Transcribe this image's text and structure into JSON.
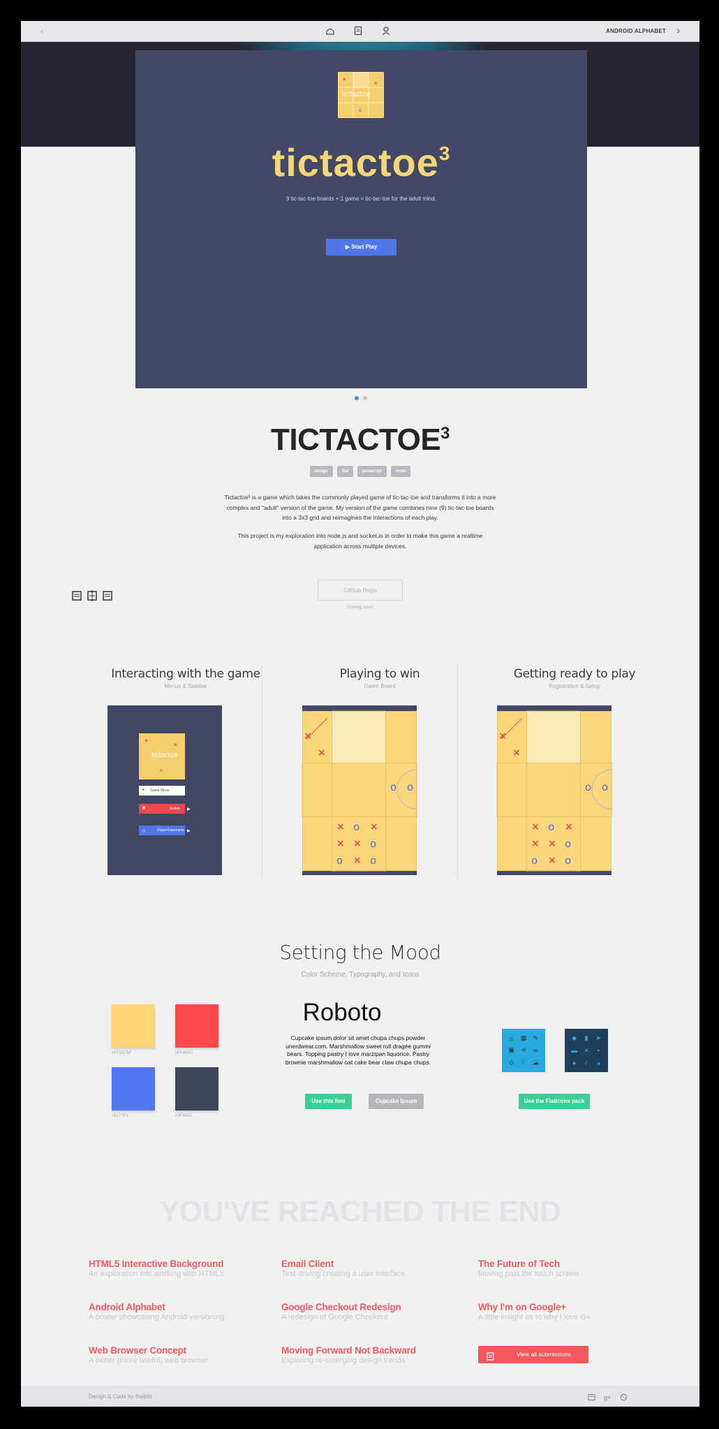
{
  "topbar": {
    "back_glyph": "‹",
    "next_label": "ANDROID ALPHABET",
    "next_glyph": "›",
    "icons": [
      "home-icon",
      "document-icon",
      "user-icon"
    ]
  },
  "hero": {
    "logo_word": "tictactoe",
    "title": "tictactoe",
    "title_sup": "3",
    "tagline": "9 tic-tac-toe boards  +  1 game  =  tic-tac-toe for the adult mind.",
    "start_button": "▶  Start Play",
    "slide_count": 2,
    "active_slide": 1
  },
  "project": {
    "title": "TICTACTOE",
    "title_sup": "3",
    "tags": [
      "design",
      "flat",
      "javascript",
      "node"
    ],
    "paragraph1": "Tictactoe³ is a game which takes the commonly played game of tic-tac-toe and transforms it into a more complex and \"adult\" version of the game. My version of the game combines nine (9) tic-tac-toe boards into a 3x3 grid and reimagines the interactions of each play.",
    "paragraph2": "This project is my exploration into node.js and socket.io in order to make this game a realtime application across multiple devices.",
    "github_button": "Github Repo",
    "github_note": "(coming soon)"
  },
  "features": [
    {
      "title": "Interacting with the game",
      "subtitle": "Menus & Sidebar"
    },
    {
      "title": "Playing to win",
      "subtitle": "Game Board"
    },
    {
      "title": "Getting ready to play",
      "subtitle": "Registration & Setup"
    }
  ],
  "menu_mock": {
    "logo_word": "tictactoe",
    "item1": "Game Menu",
    "item2": "thalida",
    "item3": "Player2username"
  },
  "mood": {
    "title": "Setting the Mood",
    "subtitle": "Color Scheme, Typography, and Icons",
    "swatches": [
      {
        "hex": "#FFD676",
        "label": "#FFD676F"
      },
      {
        "hex": "#FF494D",
        "label": "#FF494D"
      },
      {
        "hex": "#5177F1",
        "label": "#5177F1"
      },
      {
        "hex": "#3F455D",
        "label": "#3F455D"
      }
    ],
    "font_name": "Roboto",
    "font_sample": "Cupcake ipsum dolor sit amet chupa chups powder unerdwear.com. Marshmallow sweet roll dragée gummi bears. Topping pastry I love marzipan liquorice. Pastry brownie marshmallow oat cake bear claw chupa chups.",
    "use_font_button": "Use this font",
    "ipsum_button": "Cupcake Ipsum",
    "flaticons_button": "Use  the Flaticons pack",
    "iconpack_light_color": "#2aa8e0",
    "iconpack_dark_color": "#1f3f5c"
  },
  "end": {
    "title": "YOU'VE REACHED THE END",
    "links": [
      {
        "title": "HTML5 Interactive Background",
        "subtitle": "An exploration into working with HTML5"
      },
      {
        "title": "Email Client",
        "subtitle": "Test-driving creating a user interface"
      },
      {
        "title": "The Future of Tech",
        "subtitle": "Moving past the touch screen"
      },
      {
        "title": "Android Alphabet",
        "subtitle": "A poster showcasing Android versioning"
      },
      {
        "title": "Google Checkout Redesign",
        "subtitle": "A redesign of Google Checkout"
      },
      {
        "title": "Why I'm on Google+",
        "subtitle": "A little insight as to why I love G+"
      },
      {
        "title": "Web Browser Concept",
        "subtitle": "A better (more useful) web browser"
      },
      {
        "title": "Moving Forward Not Backward",
        "subtitle": "Exploring re-emerging design trends"
      }
    ],
    "view_all": "View all submissions"
  },
  "footer": {
    "credit": "Design & Code by thalida",
    "icons": [
      "email-icon",
      "google-plus-icon",
      "dribbble-icon"
    ]
  }
}
